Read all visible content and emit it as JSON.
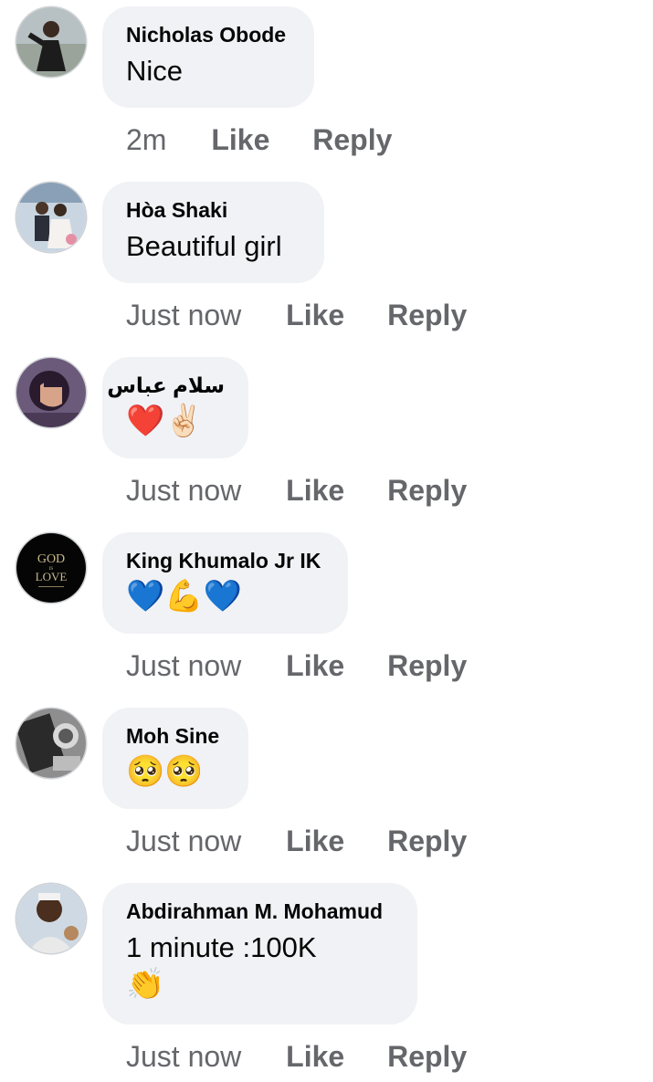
{
  "comments": [
    {
      "author": "Nicholas Obode",
      "text": "Nice",
      "time": "2m",
      "like_label": "Like",
      "reply_label": "Reply"
    },
    {
      "author": "Hòa Shaki",
      "text": "Beautiful girl",
      "time": "Just now",
      "like_label": "Like",
      "reply_label": "Reply"
    },
    {
      "author": "سلام عباس",
      "text": "❤️✌🏻",
      "time": "Just now",
      "like_label": "Like",
      "reply_label": "Reply"
    },
    {
      "author": "King Khumalo Jr IK",
      "text": "💙💪💙",
      "time": "Just now",
      "like_label": "Like",
      "reply_label": "Reply"
    },
    {
      "author": "Moh Sine",
      "text": "🥺🥺",
      "time": "Just now",
      "like_label": "Like",
      "reply_label": "Reply"
    },
    {
      "author": "Abdirahman M. Mohamud",
      "text": "1 minute :100K",
      "text_line2": "👏",
      "time": "Just now",
      "like_label": "Like",
      "reply_label": "Reply"
    }
  ],
  "avatars": {
    "god_is_love": {
      "line1": "GOD",
      "line2": "IS",
      "line3": "LOVE"
    }
  },
  "colors": {
    "bubble_bg": "#f0f2f5",
    "meta_text": "#65676b",
    "primary_text": "#050505"
  }
}
